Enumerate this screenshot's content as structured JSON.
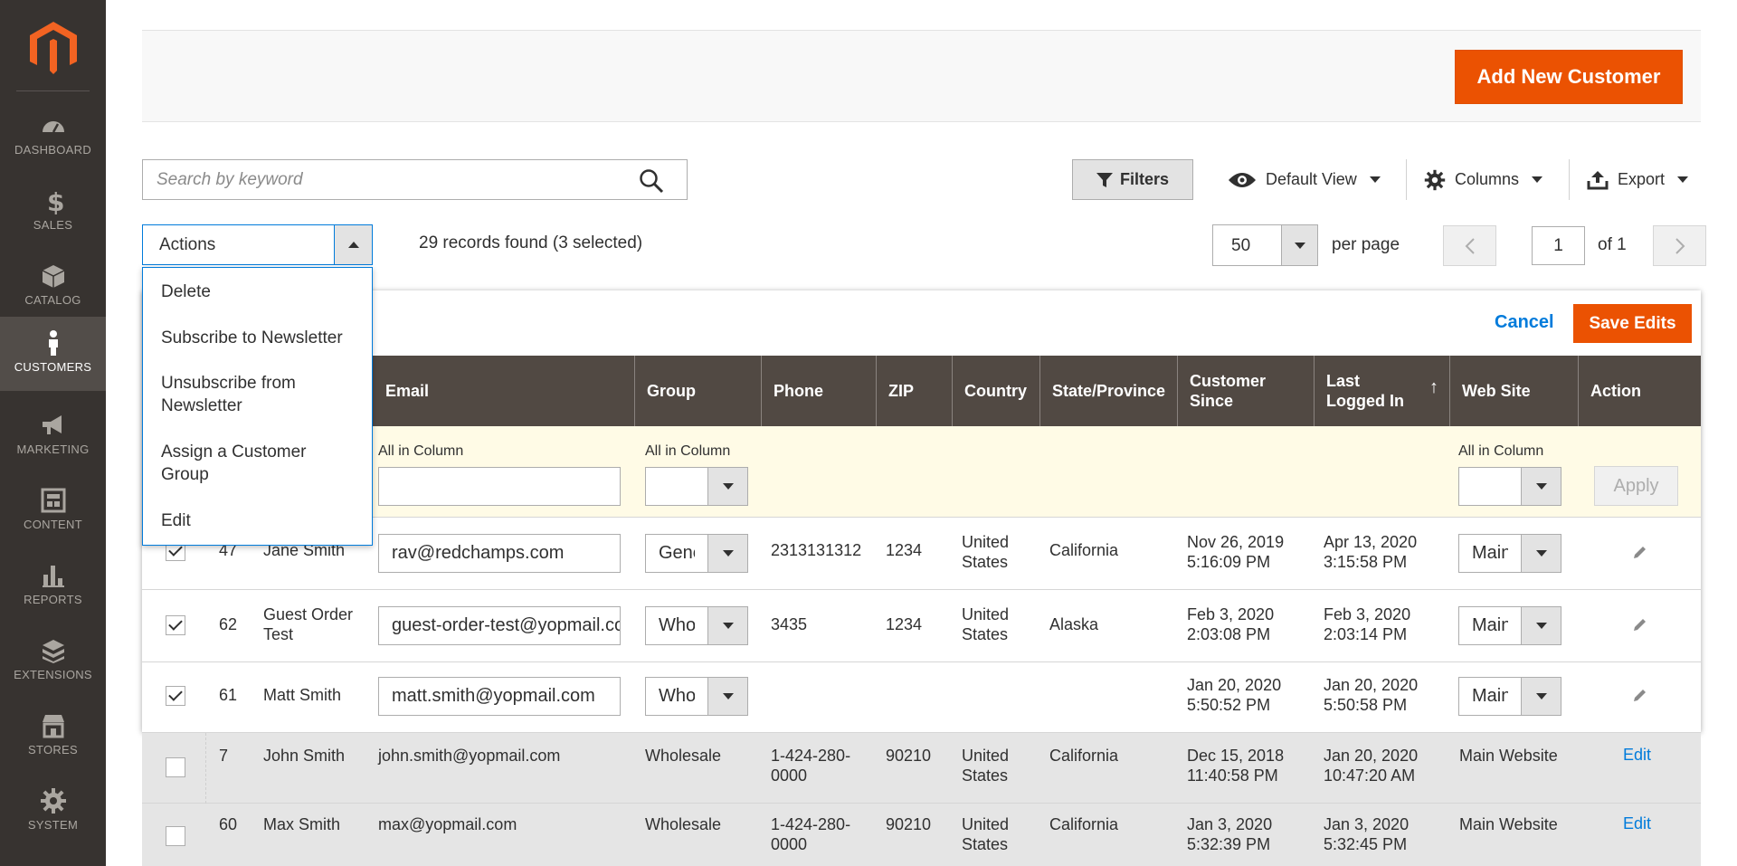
{
  "sidebar": {
    "items": [
      {
        "label": "DASHBOARD",
        "icon": "dashboard-icon"
      },
      {
        "label": "SALES",
        "icon": "dollar-icon"
      },
      {
        "label": "CATALOG",
        "icon": "box-icon"
      },
      {
        "label": "CUSTOMERS",
        "icon": "person-icon",
        "active": true
      },
      {
        "label": "MARKETING",
        "icon": "megaphone-icon"
      },
      {
        "label": "CONTENT",
        "icon": "layout-icon"
      },
      {
        "label": "REPORTS",
        "icon": "bar-chart-icon"
      },
      {
        "label": "EXTENSIONS",
        "icon": "stack-icon"
      },
      {
        "label": "STORES",
        "icon": "store-icon"
      },
      {
        "label": "SYSTEM",
        "icon": "gear-icon"
      }
    ]
  },
  "header": {
    "add_new_label": "Add New Customer"
  },
  "toolbar": {
    "search_placeholder": "Search by keyword",
    "filters_label": "Filters",
    "default_view_label": "Default View",
    "columns_label": "Columns",
    "export_label": "Export",
    "actions_label": "Actions",
    "records_text": "29 records found (3 selected)",
    "per_page_value": "50",
    "per_page_label": "per page",
    "page_value": "1",
    "page_of": "of 1"
  },
  "actions_menu": {
    "items": [
      "Delete",
      "Subscribe to Newsletter",
      "Unsubscribe from Newsletter",
      "Assign a Customer Group",
      "Edit"
    ]
  },
  "edit_bar": {
    "cancel_label": "Cancel",
    "save_label": "Save Edits"
  },
  "grid": {
    "columns": [
      "Email",
      "Group",
      "Phone",
      "ZIP",
      "Country",
      "State/Province",
      "Customer Since",
      "Last Logged In",
      "Web Site",
      "Action"
    ],
    "filter_row": {
      "all_in_column": "All in Column",
      "apply_label": "Apply"
    },
    "edit_rows": [
      {
        "id": "47",
        "name": "Jane Smith",
        "email": "rav@redchamps.com",
        "group": "General",
        "phone": "2313131312",
        "zip": "1234",
        "country": "United States",
        "state": "California",
        "since": "Nov 26, 2019 5:16:09 PM",
        "last": "Apr 13, 2020 3:15:58 PM",
        "website": "Main Website"
      },
      {
        "id": "62",
        "name": "Guest Order Test",
        "email": "guest-order-test@yopmail.com",
        "group": "Wholesale",
        "phone": "3435",
        "zip": "1234",
        "country": "United States",
        "state": "Alaska",
        "since": "Feb 3, 2020 2:03:08 PM",
        "last": "Feb 3, 2020 2:03:14 PM",
        "website": "Main Website"
      },
      {
        "id": "61",
        "name": "Matt Smith",
        "email": "matt.smith@yopmail.com",
        "group": "Wholesale",
        "phone": "",
        "zip": "",
        "country": "",
        "state": "",
        "since": "Jan 20, 2020 5:50:52 PM",
        "last": "Jan 20, 2020 5:50:58 PM",
        "website": "Main Website"
      }
    ],
    "rows": [
      {
        "id": "7",
        "name": "John Smith",
        "email": "john.smith@yopmail.com",
        "group": "Wholesale",
        "phone": "1-424-280-0000",
        "zip": "90210",
        "country": "United States",
        "state": "California",
        "since": "Dec 15, 2018 11:40:58 PM",
        "last": "Jan 20, 2020 10:47:20 AM",
        "website": "Main Website",
        "action": "Edit"
      },
      {
        "id": "60",
        "name": "Max Smith",
        "email": "max@yopmail.com",
        "group": "Wholesale",
        "phone": "1-424-280-0000",
        "zip": "90210",
        "country": "United States",
        "state": "California",
        "since": "Jan 3, 2020 5:32:39 PM",
        "last": "Jan 3, 2020 5:32:45 PM",
        "website": "Main Website",
        "action": "Edit"
      }
    ]
  },
  "colors": {
    "sidebar_bg": "#373330",
    "accent": "#eb5202",
    "link": "#007bdb",
    "grid_header": "#514943"
  }
}
